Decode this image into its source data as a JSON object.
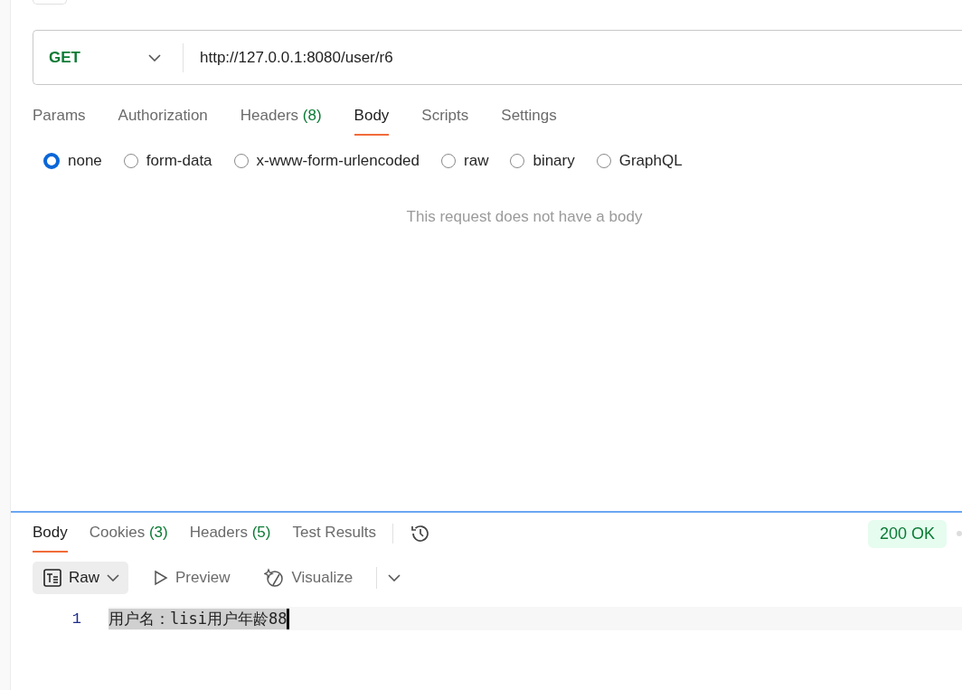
{
  "request": {
    "method": "GET",
    "url": "http://127.0.0.1:8080/user/r6"
  },
  "request_tabs": [
    {
      "label": "Params",
      "selected": false
    },
    {
      "label": "Authorization",
      "selected": false
    },
    {
      "label": "Headers",
      "count": "(8)",
      "selected": false
    },
    {
      "label": "Body",
      "selected": true
    },
    {
      "label": "Scripts",
      "selected": false
    },
    {
      "label": "Settings",
      "selected": false
    }
  ],
  "body_types": [
    {
      "label": "none",
      "selected": true
    },
    {
      "label": "form-data",
      "selected": false
    },
    {
      "label": "x-www-form-urlencoded",
      "selected": false
    },
    {
      "label": "raw",
      "selected": false
    },
    {
      "label": "binary",
      "selected": false
    },
    {
      "label": "GraphQL",
      "selected": false
    }
  ],
  "empty_message": "This request does not have a body",
  "response": {
    "tabs": [
      {
        "label": "Body",
        "selected": true
      },
      {
        "label": "Cookies",
        "count": "(3)",
        "selected": false
      },
      {
        "label": "Headers",
        "count": "(5)",
        "selected": false
      },
      {
        "label": "Test Results",
        "selected": false
      }
    ],
    "status": "200 OK",
    "view_modes": [
      {
        "kind": "raw",
        "label": "Raw",
        "selected": true
      },
      {
        "kind": "preview",
        "label": "Preview",
        "selected": false
      },
      {
        "kind": "visualize",
        "label": "Visualize",
        "selected": false
      }
    ],
    "code_lines": [
      {
        "number": "1",
        "text": "用户名：lisi用户年龄88",
        "selected": true
      }
    ]
  }
}
